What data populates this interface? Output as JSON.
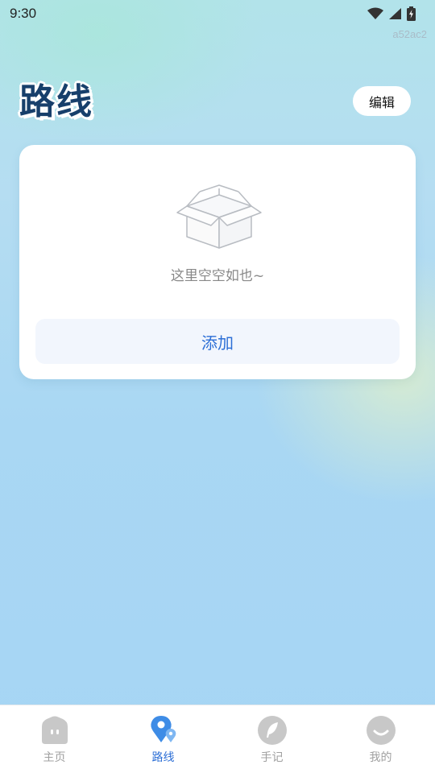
{
  "status_bar": {
    "time": "9:30",
    "icons": [
      "wifi-icon",
      "signal-icon",
      "battery-icon"
    ]
  },
  "watermark": "a52ac2",
  "header": {
    "title": "路线",
    "edit_label": "编辑"
  },
  "card": {
    "empty_icon": "empty-box-icon",
    "empty_text": "这里空空如也~",
    "add_label": "添加"
  },
  "tab_bar": {
    "active_index": 1,
    "tabs": [
      {
        "label": "主页",
        "icon": "home-icon"
      },
      {
        "label": "路线",
        "icon": "route-pin-icon"
      },
      {
        "label": "手记",
        "icon": "feather-icon"
      },
      {
        "label": "我的",
        "icon": "profile-smile-icon"
      }
    ]
  },
  "colors": {
    "accent": "#2d6fd6",
    "title": "#173f6b",
    "inactive_tab": "#a0a0a0",
    "add_button_bg": "#f2f6fd"
  }
}
